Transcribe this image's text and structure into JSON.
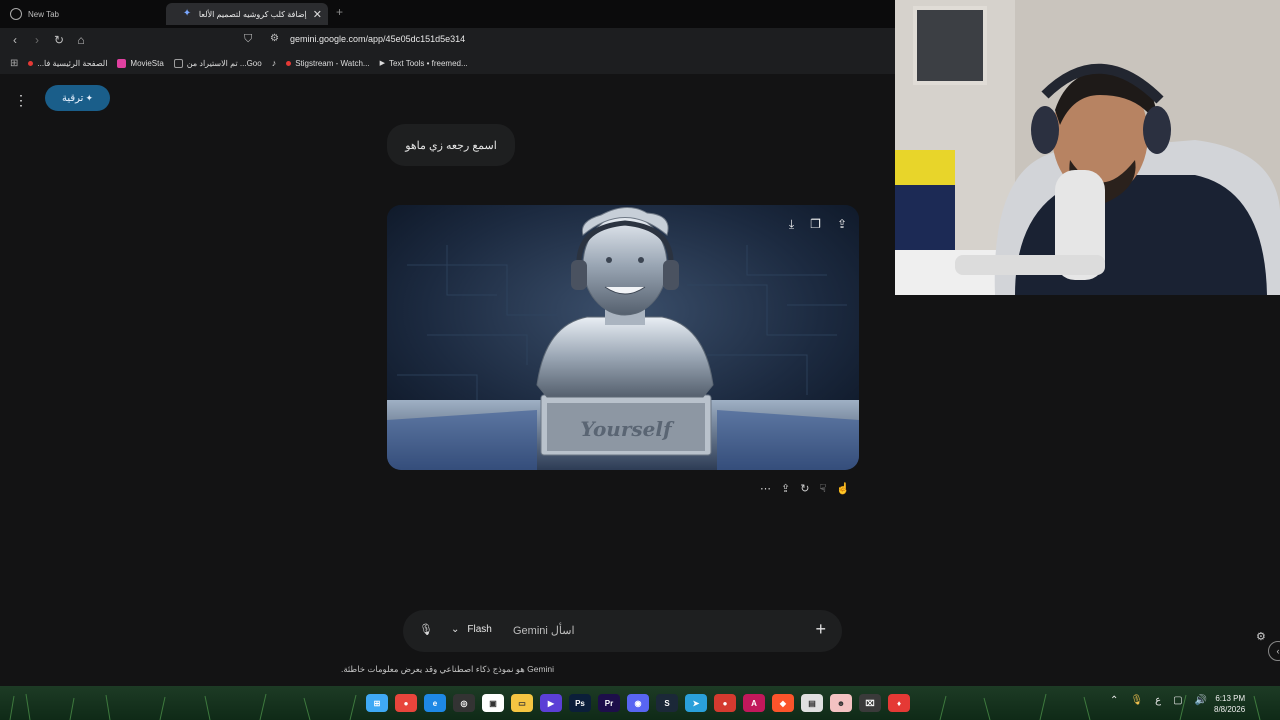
{
  "browser": {
    "tabs": [
      {
        "label": "New Tab",
        "active": false
      },
      {
        "label": "إضافة كلب كروشيه لتصميم الألعا",
        "active": true
      }
    ],
    "new_tab_glyph": "+",
    "close_glyph": "✕",
    "url": "gemini.google.com/app/45e05dc151d5e314",
    "bookmarks": [
      {
        "label": "الصفحة الرئيسية فا...",
        "color": "#e53935"
      },
      {
        "label": "MovieSta",
        "color": "#e040a0"
      },
      {
        "label": "تم الاستيراد من ...Goo",
        "color": "#9e9e9e"
      },
      {
        "label": "",
        "color": "#ffffff"
      },
      {
        "label": "Stigstream - Watch...",
        "color": "#e53935"
      },
      {
        "label": "Text Tools • freemed...",
        "color": "#ffffff"
      }
    ]
  },
  "gemini": {
    "upgrade_label": "ترقية",
    "user_prompt": "اسمع رجعه زي ماهو",
    "generated_image_text": "Yourself",
    "input_placeholder": "اسأل Gemini",
    "model_label": "Flash",
    "disclaimer": "Gemini هو نموذج ذكاء اصطناعي وقد يعرض معلومات خاطئة."
  },
  "taskbar": {
    "clock_time": "6:13 PM",
    "clock_date": "8/8/2026",
    "language_indicator": "ع",
    "apps": [
      {
        "name": "windows-start",
        "color": "#3fa9f5",
        "glyph": "⊞"
      },
      {
        "name": "chrome",
        "color": "#e8453c",
        "glyph": "●"
      },
      {
        "name": "edge",
        "color": "#1e88e5",
        "glyph": "e"
      },
      {
        "name": "obs",
        "color": "#333333",
        "glyph": "◎"
      },
      {
        "name": "store",
        "color": "#ffffff",
        "glyph": "▣"
      },
      {
        "name": "files",
        "color": "#f5c542",
        "glyph": "▭"
      },
      {
        "name": "media",
        "color": "#5b3fd6",
        "glyph": "▶"
      },
      {
        "name": "photoshop",
        "color": "#0b1e3a",
        "glyph": "Ps"
      },
      {
        "name": "premiere",
        "color": "#1d0e4a",
        "glyph": "Pr"
      },
      {
        "name": "discord",
        "color": "#5865f2",
        "glyph": "◉"
      },
      {
        "name": "steam",
        "color": "#1b2838",
        "glyph": "S"
      },
      {
        "name": "telegram",
        "color": "#2aa0da",
        "glyph": "➤"
      },
      {
        "name": "record",
        "color": "#d43a2f",
        "glyph": "●"
      },
      {
        "name": "app-a",
        "color": "#c2185b",
        "glyph": "A"
      },
      {
        "name": "brave",
        "color": "#fb542b",
        "glyph": "◆"
      },
      {
        "name": "app-b",
        "color": "#e0e0e0",
        "glyph": "▤"
      },
      {
        "name": "app-c",
        "color": "#f4c2c2",
        "glyph": "☻"
      },
      {
        "name": "app-d",
        "color": "#3a3a3a",
        "glyph": "⌧"
      },
      {
        "name": "app-e",
        "color": "#e53935",
        "glyph": "♦"
      }
    ]
  }
}
